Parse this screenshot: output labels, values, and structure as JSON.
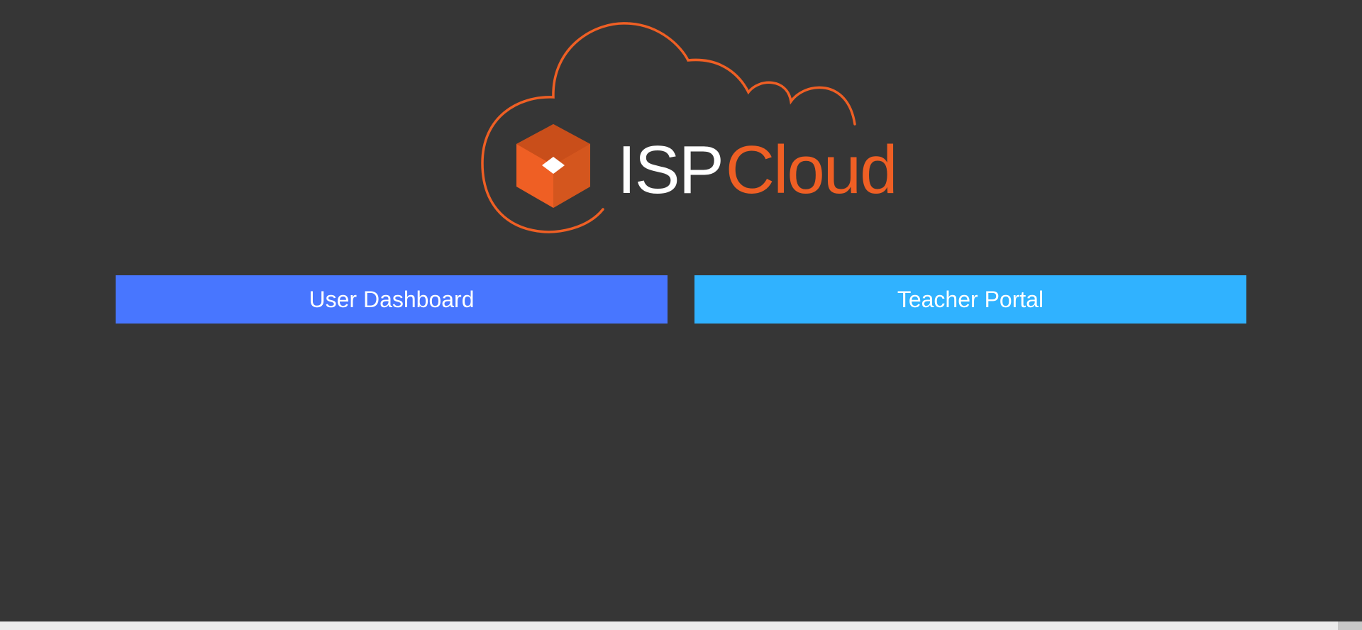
{
  "logo": {
    "text_primary": "ISP",
    "text_secondary": "Cloud",
    "accent_color": "#ef5f24",
    "icon": "cloud-cube-logo-icon"
  },
  "actions": {
    "user_dashboard": {
      "label": "User Dashboard",
      "color": "#4876ff"
    },
    "teacher_portal": {
      "label": "Teacher Portal",
      "color": "#30b2ff"
    }
  },
  "theme": {
    "background": "#363636"
  }
}
